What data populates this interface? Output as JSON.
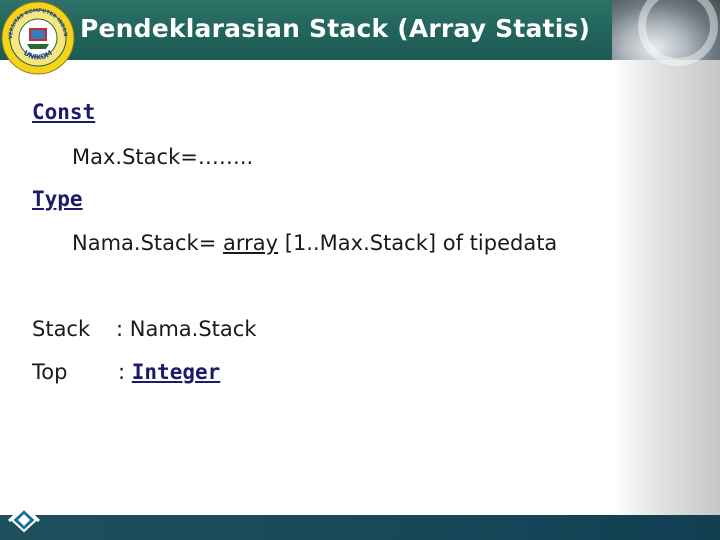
{
  "slide": {
    "title": "Pendeklarasian Stack (Array Statis)",
    "logo_text": {
      "top": "UNIVERSITAS KOMPUTER INDONESIA",
      "bottom": "UNIKOM"
    },
    "colors": {
      "title_bar": "#23665d",
      "bottom_bar": "#16485a",
      "keyword": "#1b1b6b"
    }
  },
  "code": {
    "const_keyword": "Const",
    "const_line": "Max.Stack=……..",
    "type_keyword": "Type",
    "type_line_prefix": "Nama.Stack= ",
    "type_line_array": "array",
    "type_line_suffix": " [1..Max.Stack] of tipedata",
    "stack_var_name": "Stack",
    "stack_var_sep": ": ",
    "stack_var_type": "Nama.Stack",
    "top_var_name": "Top",
    "top_var_sep": ": ",
    "top_var_type": "Integer"
  },
  "icons": {
    "logo": "university-seal-icon",
    "nav": "diamond-nav-icon"
  }
}
